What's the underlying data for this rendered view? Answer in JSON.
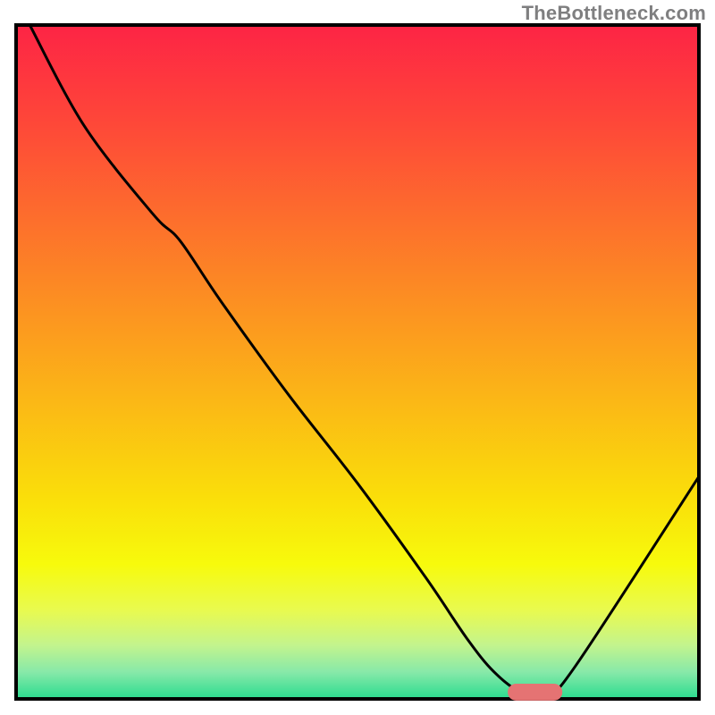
{
  "watermark": "TheBottleneck.com",
  "chart_data": {
    "type": "line",
    "title": "",
    "xlabel": "",
    "ylabel": "",
    "xlim": [
      0,
      100
    ],
    "ylim": [
      0,
      100
    ],
    "x": [
      2,
      10,
      20,
      24,
      30,
      40,
      50,
      60,
      66,
      70,
      74,
      78,
      82,
      100
    ],
    "y": [
      100,
      85,
      72,
      68,
      59,
      45,
      32,
      18,
      9,
      4,
      1,
      1,
      5,
      33
    ],
    "marker": {
      "present": true,
      "x": 76,
      "y": 1,
      "width": 8,
      "height": 2.5,
      "color": "#e57373",
      "shape": "rounded-rect"
    },
    "gradient_stops": [
      {
        "offset": 0.0,
        "color": "#fd2445"
      },
      {
        "offset": 0.14,
        "color": "#fe4639"
      },
      {
        "offset": 0.28,
        "color": "#fd6c2d"
      },
      {
        "offset": 0.42,
        "color": "#fc9221"
      },
      {
        "offset": 0.56,
        "color": "#fbb816"
      },
      {
        "offset": 0.7,
        "color": "#fade0a"
      },
      {
        "offset": 0.8,
        "color": "#f7fa0c"
      },
      {
        "offset": 0.87,
        "color": "#e8fa51"
      },
      {
        "offset": 0.92,
        "color": "#c3f48d"
      },
      {
        "offset": 0.96,
        "color": "#88e9a9"
      },
      {
        "offset": 1.0,
        "color": "#2adb8f"
      }
    ],
    "frame": {
      "stroke": "#000000",
      "strokeWidth": 4
    },
    "curve_style": {
      "stroke": "#000000",
      "strokeWidth": 3
    }
  }
}
